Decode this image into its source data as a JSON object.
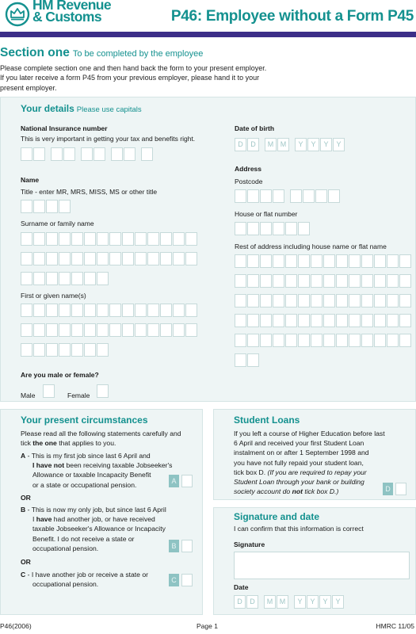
{
  "header": {
    "brand_line1": "HM Revenue",
    "brand_line2": "& Customs",
    "logo_icon": "crown-icon",
    "title": "P46: Employee without a Form P45"
  },
  "section": {
    "title": "Section one",
    "subtitle": "To be completed by the employee",
    "intro_line1": "Please complete section one and then hand back the form to your present employer.",
    "intro_line2": "If you later receive a form P45 from your previous employer, please hand it to your",
    "intro_line3": "present employer."
  },
  "your_details": {
    "title": "Your details",
    "subtitle": "Please use capitals",
    "ni_label": "National Insurance number",
    "ni_hint": "This is very important in getting your tax and benefits right.",
    "ni_value": "",
    "dob_label": "Date of birth",
    "dob_placeholders": [
      "D",
      "D",
      "M",
      "M",
      "Y",
      "Y",
      "Y",
      "Y"
    ],
    "name_label": "Name",
    "title_hint": "Title - enter MR, MRS, MISS, MS or other title",
    "title_value": "",
    "surname_label": "Surname or family name",
    "surname_value": "",
    "first_name_label": "First or given name(s)",
    "first_name_value": "",
    "gender_question": "Are you male or female?",
    "male_label": "Male",
    "female_label": "Female",
    "address_label": "Address",
    "postcode_label": "Postcode",
    "postcode_value": "",
    "house_label": "House or flat number",
    "house_value": "",
    "rest_address_label": "Rest of address including house name or flat name",
    "rest_address_value": ""
  },
  "circumstances": {
    "title": "Your present circumstances",
    "intro_1": "Please read all the following statements carefully and",
    "intro_2a": "tick ",
    "intro_2b": "the one",
    "intro_2c": " that applies to you.",
    "a_key": "A",
    "a_line1": " - This is my first job since last 6 April and",
    "a_line2_bold": "I have not",
    "a_line2": " been receiving taxable Jobseeker's",
    "a_line3": "Allowance or taxable Incapacity Benefit",
    "a_line4": "or a state or occupational pension.",
    "or_1": "OR",
    "b_key": "B",
    "b_line1": " - This is now my only job, but since last 6 April",
    "b_line2a": "I ",
    "b_line2_bold": "have",
    "b_line2": " had another job, or have received",
    "b_line3": "taxable Jobseeker's Allowance or Incapacity",
    "b_line4": "Benefit. I do not receive a state or",
    "b_line5": "occupational pension.",
    "or_2": "OR",
    "c_key": "C",
    "c_line1": " - I have another job or receive a state or",
    "c_line2": "occupational pension.",
    "tick_a": "A",
    "tick_b": "B",
    "tick_c": "C",
    "tick_a_checked": false,
    "tick_b_checked": false,
    "tick_c_checked": false
  },
  "student_loans": {
    "title": "Student Loans",
    "line1": "If you left a course of Higher Education before last",
    "line2": "6 April and received your first Student Loan",
    "line3": "instalment on or after 1 September 1998 and",
    "line4": "you have not fully repaid your student loan,",
    "line5a": "tick box D. ",
    "line5b": "(If you are required to repay your",
    "line6": "Student Loan through your bank or building",
    "line7a": "society account do ",
    "line7_bold": "not",
    "line7b": " tick box D.)",
    "tick_d": "D",
    "tick_d_checked": false
  },
  "signature": {
    "title": "Signature and date",
    "confirm": "I can confirm that this information is correct",
    "signature_label": "Signature",
    "signature_value": "",
    "date_label": "Date",
    "date_placeholders": [
      "D",
      "D",
      "M",
      "M",
      "Y",
      "Y",
      "Y",
      "Y"
    ]
  },
  "footer": {
    "form_code": "P46(2006)",
    "page": "Page 1",
    "version": "HMRC 11/05"
  }
}
